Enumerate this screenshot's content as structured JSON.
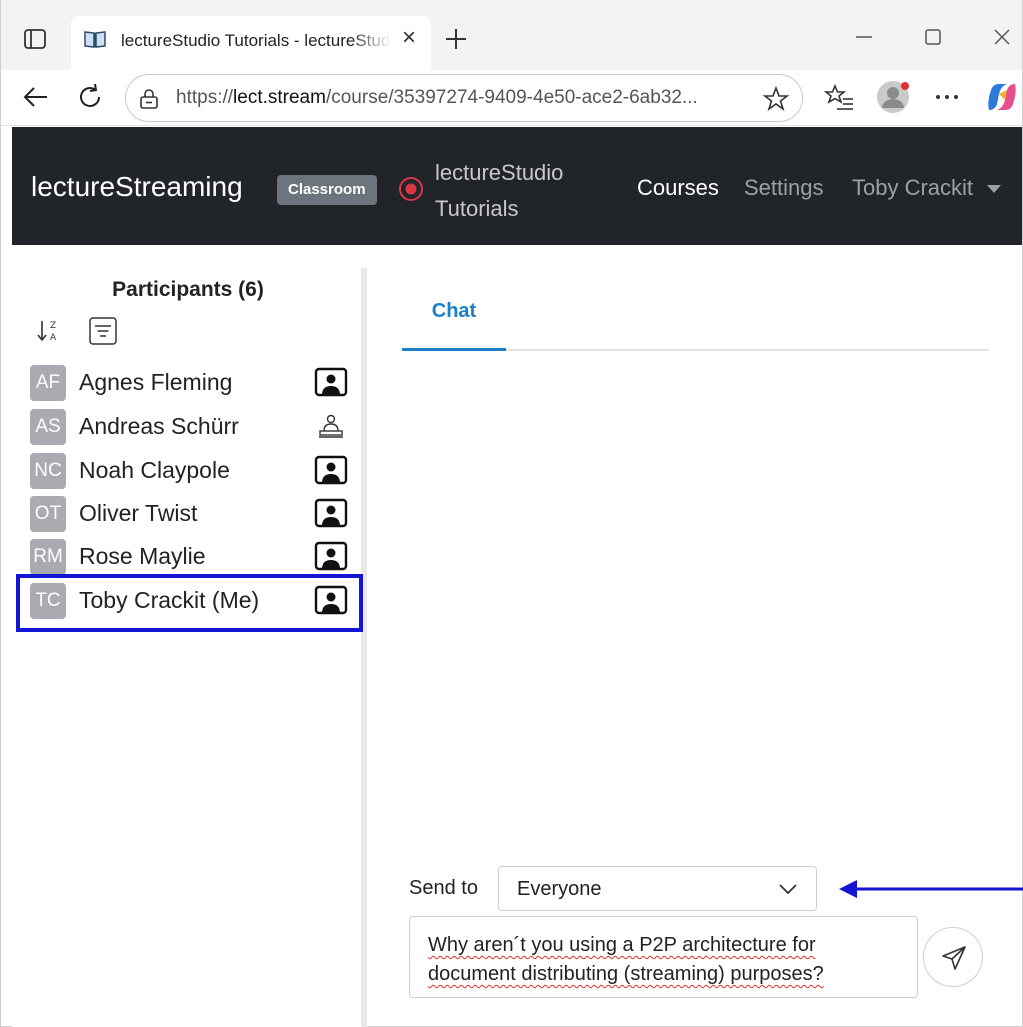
{
  "browser": {
    "tab_title": "lectureStudio Tutorials - lectureStudio",
    "url_prefix": "https://",
    "url_domain": "lect.stream",
    "url_path": "/course/35397274-9409-4e50-ace2-6ab32...",
    "icons": {
      "tab_actions": "tab-actions-icon",
      "favicon": "book-icon",
      "close": "close-icon",
      "new_tab": "plus-icon",
      "minimize": "minimize-icon",
      "maximize": "maximize-icon",
      "window_close": "close-icon",
      "back": "back-arrow-icon",
      "refresh": "refresh-icon",
      "site_info": "lock-icon",
      "favorite": "star-icon",
      "favorites_list": "favorites-icon",
      "profile": "profile-icon",
      "more": "more-icon",
      "copilot": "copilot-icon"
    }
  },
  "header": {
    "brand": "lectureStreaming",
    "badge": "Classroom",
    "course_title": "lectureStudio Tutorials",
    "nav": {
      "courses": "Courses",
      "settings": "Settings",
      "user": "Toby Crackit"
    },
    "colors": {
      "background": "#212529",
      "badge": "#6c757d",
      "recording": "#dc3545"
    }
  },
  "participants": {
    "title": "Participants (6)",
    "list": [
      {
        "initials": "AF",
        "name": "Agnes Fleming",
        "icon": "video-person-icon"
      },
      {
        "initials": "AS",
        "name": "Andreas Schürr",
        "icon": "presenter-icon"
      },
      {
        "initials": "NC",
        "name": "Noah Claypole",
        "icon": "video-person-icon"
      },
      {
        "initials": "OT",
        "name": "Oliver Twist",
        "icon": "video-person-icon"
      },
      {
        "initials": "RM",
        "name": "Rose Maylie",
        "icon": "video-person-icon"
      },
      {
        "initials": "TC",
        "name": "Toby Crackit (Me)",
        "icon": "video-person-icon"
      }
    ],
    "highlight_color": "#1414d4"
  },
  "chat": {
    "tab_label": "Chat",
    "send_to_label": "Send to",
    "recipient": "Everyone",
    "message_line1": "Why aren´t you using a P2P architecture for",
    "message_line2": "document distributing (streaming) purposes?",
    "accent_color": "#1b7fc9",
    "arrow_color": "#1414d4"
  }
}
